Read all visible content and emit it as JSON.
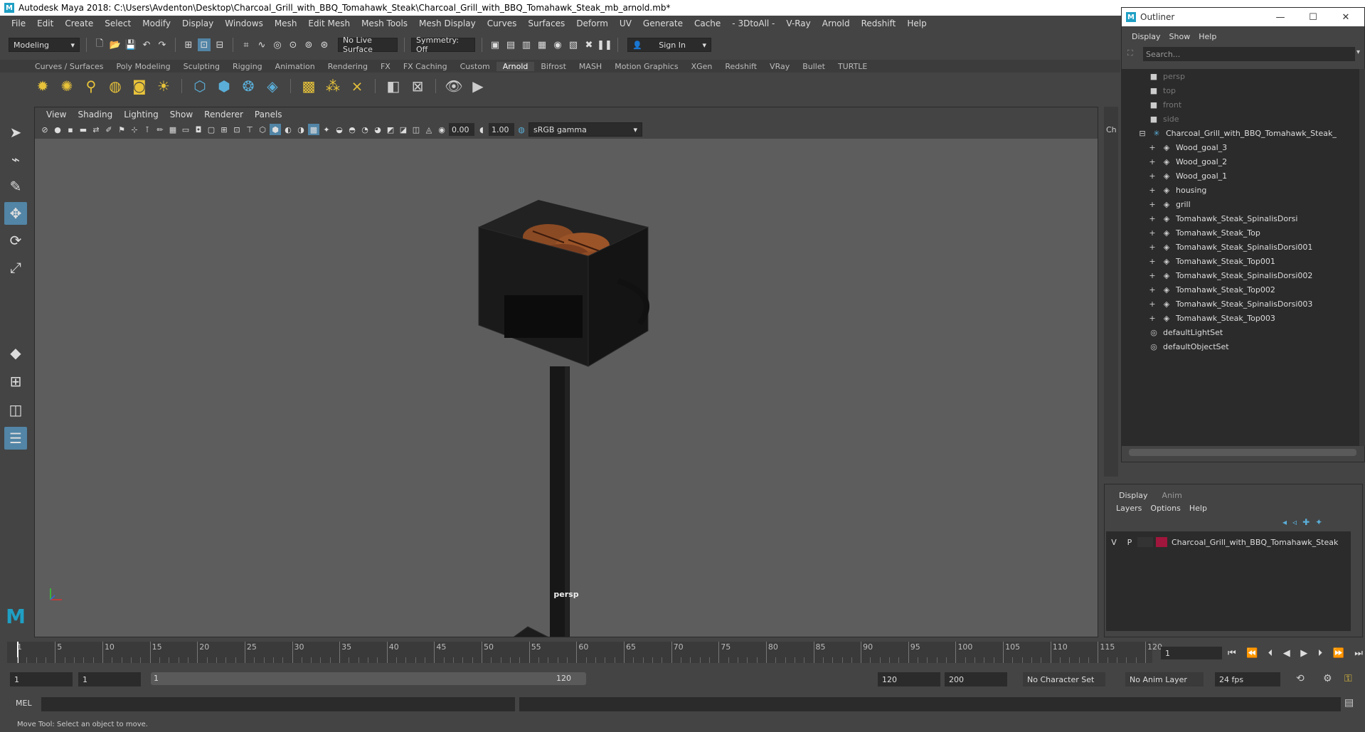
{
  "app": {
    "title": "Autodesk Maya 2018: C:\\Users\\Avdenton\\Desktop\\Charcoal_Grill_with_BBQ_Tomahawk_Steak\\Charcoal_Grill_with_BBQ_Tomahawk_Steak_mb_arnold.mb*"
  },
  "menubar": [
    "File",
    "Edit",
    "Create",
    "Select",
    "Modify",
    "Display",
    "Windows",
    "Mesh",
    "Edit Mesh",
    "Mesh Tools",
    "Mesh Display",
    "Curves",
    "Surfaces",
    "Deform",
    "UV",
    "Generate",
    "Cache",
    "- 3DtoAll -",
    "V-Ray",
    "Arnold",
    "Redshift",
    "Help"
  ],
  "statusline": {
    "mode": "Modeling",
    "live_surface": "No Live Surface",
    "symmetry": "Symmetry: Off",
    "sign_in": "Sign In"
  },
  "shelf": {
    "tabs": [
      "Curves / Surfaces",
      "Poly Modeling",
      "Sculpting",
      "Rigging",
      "Animation",
      "Rendering",
      "FX",
      "FX Caching",
      "Custom",
      "Arnold",
      "Bifrost",
      "MASH",
      "Motion Graphics",
      "XGen",
      "Redshift",
      "VRay",
      "Bullet",
      "TURTLE"
    ],
    "active_tab": "Arnold"
  },
  "viewport": {
    "menu": [
      "View",
      "Shading",
      "Lighting",
      "Show",
      "Renderer",
      "Panels"
    ],
    "exposure": "0.00",
    "gamma": "1.00",
    "color_space": "sRGB gamma",
    "camera": "persp"
  },
  "side_strip_label": "Ch",
  "outliner": {
    "title": "Outliner",
    "menu": [
      "Display",
      "Show",
      "Help"
    ],
    "search_placeholder": "Search...",
    "cameras": [
      "persp",
      "top",
      "front",
      "side"
    ],
    "root": "Charcoal_Grill_with_BBQ_Tomahawk_Steak_",
    "children": [
      "Wood_goal_3",
      "Wood_goal_2",
      "Wood_goal_1",
      "housing",
      "grill",
      "Tomahawk_Steak_SpinalisDorsi",
      "Tomahawk_Steak_Top",
      "Tomahawk_Steak_SpinalisDorsi001",
      "Tomahawk_Steak_Top001",
      "Tomahawk_Steak_SpinalisDorsi002",
      "Tomahawk_Steak_Top002",
      "Tomahawk_Steak_SpinalisDorsi003",
      "Tomahawk_Steak_Top003"
    ],
    "sets": [
      "defaultLightSet",
      "defaultObjectSet"
    ]
  },
  "layers": {
    "tabs": [
      "Display",
      "Anim"
    ],
    "menu": [
      "Layers",
      "Options",
      "Help"
    ],
    "row": {
      "v": "V",
      "p": "P",
      "name": "Charcoal_Grill_with_BBQ_Tomahawk_Steak",
      "color": "#a0163c"
    }
  },
  "timeline": {
    "ticks": [
      5,
      10,
      15,
      20,
      25,
      30,
      35,
      40,
      45,
      50,
      55,
      60,
      65,
      70,
      75,
      80,
      85,
      90,
      95,
      100,
      105,
      110,
      115,
      120
    ],
    "start_label": "1",
    "current_frame": "1"
  },
  "range": {
    "start": "1",
    "playback_start": "1",
    "slider_start": "1",
    "slider_end": "120",
    "playback_end": "120",
    "end": "200",
    "character_set": "No Character Set",
    "anim_layer": "No Anim Layer",
    "fps": "24 fps"
  },
  "command": {
    "label": "MEL",
    "help": "Move Tool: Select an object to move."
  },
  "colors": {
    "accent": "#5285a6",
    "maya_logo": "#1f9fc4"
  }
}
